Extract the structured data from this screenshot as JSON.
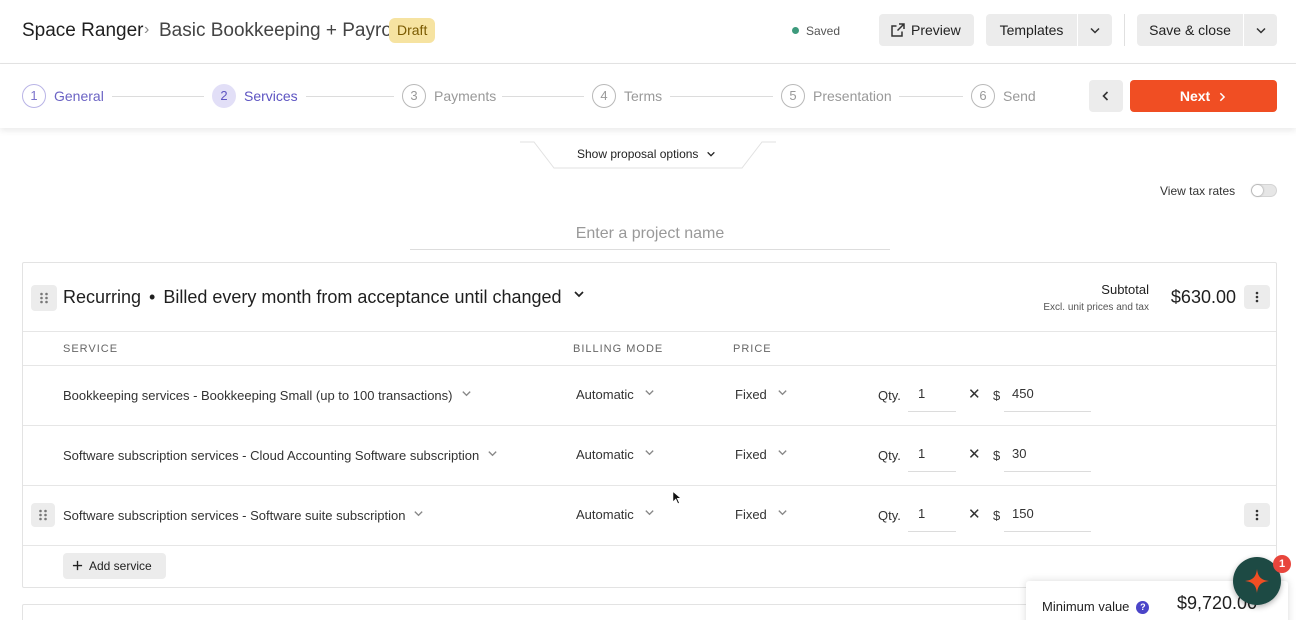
{
  "header": {
    "brand": "Space Ranger",
    "breadcrumb_separator": "›",
    "document_title": "Basic Bookkeeping + Payroll",
    "status_badge": "Draft",
    "save_status": "Saved",
    "preview_label": "Preview",
    "templates_label": "Templates",
    "save_close_label": "Save & close"
  },
  "stepper": {
    "steps": [
      {
        "number": "1",
        "label": "General",
        "state": "done"
      },
      {
        "number": "2",
        "label": "Services",
        "state": "active"
      },
      {
        "number": "3",
        "label": "Payments",
        "state": "upcoming"
      },
      {
        "number": "4",
        "label": "Terms",
        "state": "upcoming"
      },
      {
        "number": "5",
        "label": "Presentation",
        "state": "upcoming"
      },
      {
        "number": "6",
        "label": "Send",
        "state": "upcoming"
      }
    ],
    "next_label": "Next"
  },
  "options": {
    "show_options_label": "Show proposal options",
    "tax_toggle_label": "View tax rates",
    "tax_toggle_on": false
  },
  "project": {
    "name_value": "",
    "name_placeholder": "Enter a project name"
  },
  "recurring": {
    "title": "Recurring",
    "separator": "•",
    "billing_cycle": "Billed every month from acceptance until changed",
    "subtotal_label": "Subtotal",
    "subtotal_note": "Excl. unit prices and tax",
    "subtotal_value": "$630.00",
    "columns": {
      "service": "SERVICE",
      "billing_mode": "BILLING MODE",
      "price": "PRICE"
    },
    "rows": [
      {
        "service": "Bookkeeping services - Bookkeeping Small (up to 100 transactions)",
        "billing_mode": "Automatic",
        "price_type": "Fixed",
        "qty_label": "Qty.",
        "qty": "1",
        "times": "✕",
        "currency": "$",
        "price": "450"
      },
      {
        "service": "Software subscription services - Cloud Accounting Software subscription",
        "billing_mode": "Automatic",
        "price_type": "Fixed",
        "qty_label": "Qty.",
        "qty": "1",
        "times": "✕",
        "currency": "$",
        "price": "30"
      },
      {
        "service": "Software subscription services - Software suite subscription",
        "billing_mode": "Automatic",
        "price_type": "Fixed",
        "qty_label": "Qty.",
        "qty": "1",
        "times": "✕",
        "currency": "$",
        "price": "150"
      }
    ],
    "add_service_label": "Add service"
  },
  "summary": {
    "minimum_value_label": "Minimum value",
    "help_glyph": "?",
    "minimum_value": "$9,720.00"
  },
  "assistant": {
    "badge_count": "1"
  },
  "colors": {
    "accent": "#5d54c2",
    "next_button": "#f04e23",
    "draft_badge": "#f6e3a1",
    "saved_dot": "#3d9a7c",
    "assistant_bg": "#1d4a44",
    "assistant_star": "#f04e23"
  }
}
